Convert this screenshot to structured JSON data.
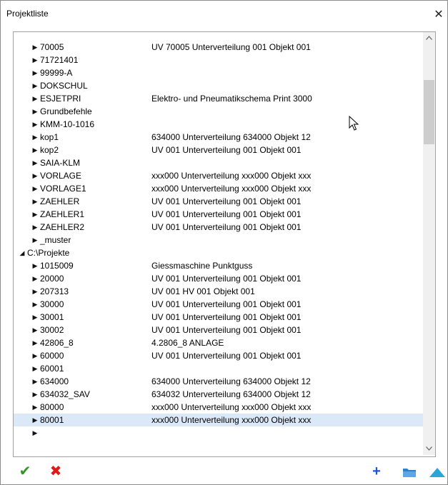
{
  "window": {
    "title": "Projektliste",
    "close_glyph": "✕"
  },
  "tree": {
    "expanded_glyph": "◢",
    "collapsed_glyph": "▶",
    "rows": [
      {
        "level": 1,
        "expanded": false,
        "name": "70005",
        "desc": "UV 70005 Unterverteilung 001 Objekt 001"
      },
      {
        "level": 1,
        "expanded": false,
        "name": "71721401",
        "desc": ""
      },
      {
        "level": 1,
        "expanded": false,
        "name": "99999-A",
        "desc": ""
      },
      {
        "level": 1,
        "expanded": false,
        "name": "DOKSCHUL",
        "desc": ""
      },
      {
        "level": 1,
        "expanded": false,
        "name": "ESJETPRI",
        "desc": "Elektro- und Pneumatikschema Print 3000"
      },
      {
        "level": 1,
        "expanded": false,
        "name": "Grundbefehle",
        "desc": ""
      },
      {
        "level": 1,
        "expanded": false,
        "name": "KMM-10-1016",
        "desc": ""
      },
      {
        "level": 1,
        "expanded": false,
        "name": "kop1",
        "desc": "634000 Unterverteilung 634000 Objekt 12"
      },
      {
        "level": 1,
        "expanded": false,
        "name": "kop2",
        "desc": "UV 001 Unterverteilung 001 Objekt 001"
      },
      {
        "level": 1,
        "expanded": false,
        "name": "SAIA-KLM",
        "desc": ""
      },
      {
        "level": 1,
        "expanded": false,
        "name": "VORLAGE",
        "desc": "xxx000 Unterverteilung xxx000 Objekt xxx"
      },
      {
        "level": 1,
        "expanded": false,
        "name": "VORLAGE1",
        "desc": "xxx000 Unterverteilung xxx000 Objekt xxx"
      },
      {
        "level": 1,
        "expanded": false,
        "name": "ZAEHLER",
        "desc": "UV 001 Unterverteilung 001 Objekt 001"
      },
      {
        "level": 1,
        "expanded": false,
        "name": "ZAEHLER1",
        "desc": "UV 001 Unterverteilung 001 Objekt 001"
      },
      {
        "level": 1,
        "expanded": false,
        "name": "ZAEHLER2",
        "desc": "UV 001 Unterverteilung 001 Objekt 001"
      },
      {
        "level": 1,
        "expanded": false,
        "name": "_muster",
        "desc": ""
      },
      {
        "level": 0,
        "expanded": true,
        "name": "C:\\Projekte",
        "desc": ""
      },
      {
        "level": 1,
        "expanded": false,
        "name": "1015009",
        "desc": "Giessmaschine Punktguss"
      },
      {
        "level": 1,
        "expanded": false,
        "name": "20000",
        "desc": "UV 001 Unterverteilung 001 Objekt 001"
      },
      {
        "level": 1,
        "expanded": false,
        "name": "207313",
        "desc": "UV 001 HV 001 Objekt 001"
      },
      {
        "level": 1,
        "expanded": false,
        "name": "30000",
        "desc": "UV 001 Unterverteilung 001 Objekt 001"
      },
      {
        "level": 1,
        "expanded": false,
        "name": "30001",
        "desc": "UV 001 Unterverteilung 001 Objekt 001"
      },
      {
        "level": 1,
        "expanded": false,
        "name": "30002",
        "desc": "UV 001 Unterverteilung 001 Objekt 001"
      },
      {
        "level": 1,
        "expanded": false,
        "name": "42806_8",
        "desc": "4.2806_8 ANLAGE"
      },
      {
        "level": 1,
        "expanded": false,
        "name": "60000",
        "desc": "UV 001 Unterverteilung 001 Objekt 001"
      },
      {
        "level": 1,
        "expanded": false,
        "name": "60001",
        "desc": ""
      },
      {
        "level": 1,
        "expanded": false,
        "name": "634000",
        "desc": "634000 Unterverteilung 634000 Objekt 12"
      },
      {
        "level": 1,
        "expanded": false,
        "name": "634032_SAV",
        "desc": "634032 Unterverteilung 634000 Objekt 12"
      },
      {
        "level": 1,
        "expanded": false,
        "name": "80000",
        "desc": "xxx000 Unterverteilung xxx000 Objekt xxx"
      },
      {
        "level": 1,
        "expanded": false,
        "name": "80001",
        "desc": "xxx000 Unterverteilung xxx000 Objekt xxx",
        "selected": true
      },
      {
        "level": 1,
        "expanded": false,
        "name": "",
        "desc": ""
      }
    ]
  },
  "scrollbar": {
    "up_glyph": "^",
    "down_glyph": "v"
  },
  "toolbar": {
    "ok_glyph": "✔",
    "cancel_glyph": "✖",
    "add_glyph": "+",
    "folder_icon": "folder-icon",
    "up_icon": "triangle-up-icon"
  },
  "colors": {
    "selection": "#dbe8f8",
    "ok": "#2e9a1e",
    "cancel": "#e01818",
    "add": "#1a55d8",
    "up_triangle": "#29a5d8"
  }
}
